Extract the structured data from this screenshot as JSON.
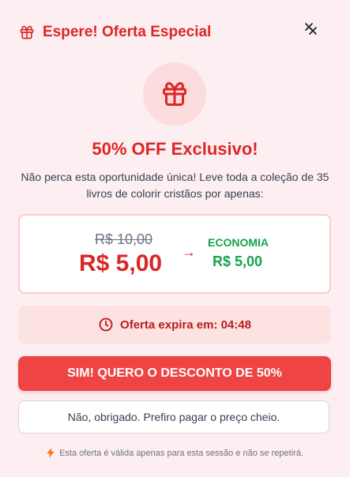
{
  "header": {
    "title": "Espere! Oferta Especial",
    "icon": "gift-icon",
    "close_icon": "close-icon"
  },
  "hero": {
    "icon": "gift-icon",
    "headline": "50% OFF Exclusivo!",
    "description": "Não perca esta oportunidade única! Leve toda a coleção de 35 livros de colorir cristãos por apenas:"
  },
  "pricing": {
    "old_price": "R$ 10,00",
    "new_price": "R$ 5,00",
    "arrow": "→",
    "economy_label": "ECONOMIA",
    "economy_value": "R$ 5,00"
  },
  "timer": {
    "icon": "clock-icon",
    "text": "Oferta expira em: 04:48"
  },
  "actions": {
    "accept_label": "SIM! QUERO O DESCONTO DE 50%",
    "decline_label": "Não, obrigado. Prefiro pagar o preço cheio."
  },
  "footer": {
    "icon": "lightning-icon",
    "note": "Esta oferta é válida apenas para esta sessão e não se repetirá."
  },
  "colors": {
    "accent": "#dc2626",
    "success": "#16a34a",
    "background": "#fdeff1"
  }
}
